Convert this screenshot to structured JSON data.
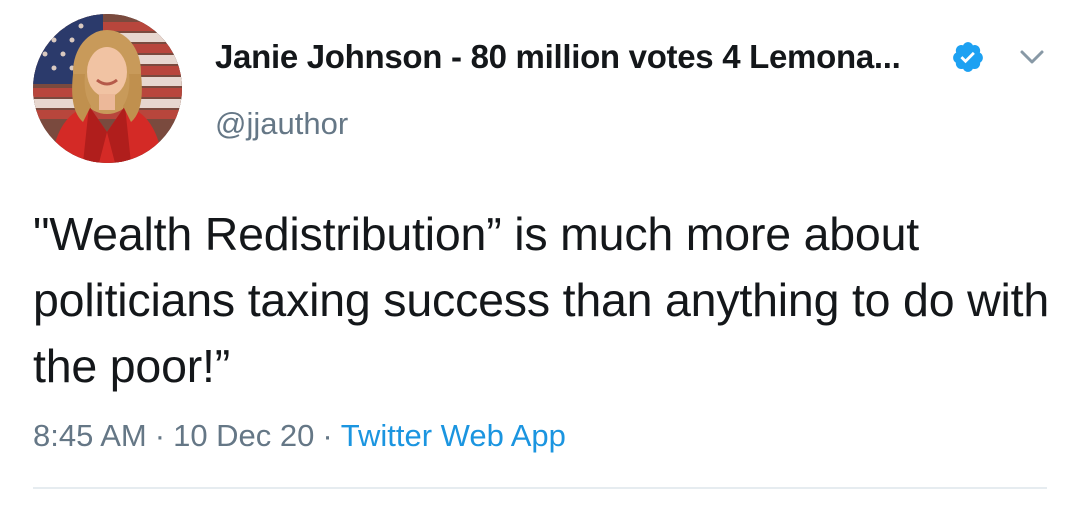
{
  "tweet": {
    "author": {
      "display_name": "Janie Johnson - 80 million votes 4 Lemona...",
      "handle": "@jjauthor",
      "verified": true,
      "avatar_icon": "profile-photo"
    },
    "text": "\"Wealth Redistribution” is much more about politicians taxing success than anything to do with the poor!”",
    "time": "8:45 AM",
    "date": "10 Dec 20",
    "separator": "·",
    "source": "Twitter Web App"
  },
  "icons": {
    "verified": "verified-badge-icon",
    "menu": "chevron-down-icon"
  },
  "colors": {
    "verified_blue": "#1da1f2",
    "link_blue": "#1b95e0",
    "secondary_text": "#657786",
    "primary_text": "#14171a"
  }
}
